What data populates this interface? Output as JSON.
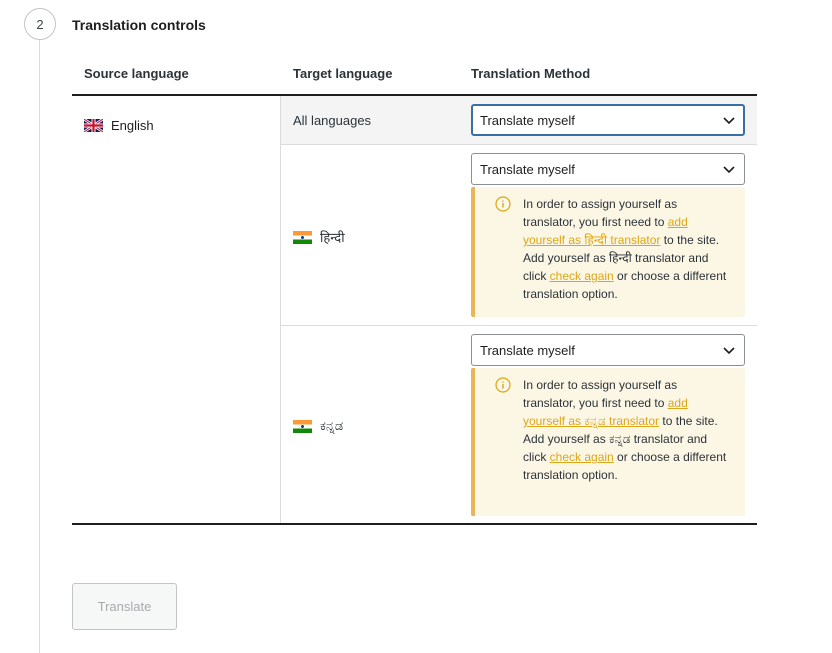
{
  "step": {
    "number": "2",
    "title": "Translation controls"
  },
  "table": {
    "headers": {
      "source": "Source language",
      "target": "Target language",
      "method": "Translation Method"
    },
    "source_language": {
      "name": "English",
      "flag": "uk-flag-icon"
    },
    "all_languages": {
      "label": "All languages",
      "method": "Translate myself"
    },
    "languages": [
      {
        "name": "हिन्दी",
        "flag": "india-flag-icon",
        "method": "Translate myself",
        "notice": {
          "text1": "In order to assign yourself as translator, you first need to ",
          "link1": "add yourself as हिन्दी translator",
          "text2": " to the site.",
          "text3": "Add yourself as हिन्दी translator and click ",
          "link2": "check again",
          "text4": " or choose a different translation option."
        }
      },
      {
        "name": "ಕನ್ನಡ",
        "flag": "india-flag-icon",
        "method": "Translate myself",
        "notice": {
          "text1": "In order to assign yourself as translator, you first need to ",
          "link1": "add yourself as ಕನ್ನಡ translator",
          "text2": " to the site.",
          "text3": "Add yourself as ಕನ್ನಡ translator and click ",
          "link2": "check again",
          "text4": " or choose a different translation option."
        }
      }
    ]
  },
  "translate_button": {
    "label": "Translate",
    "disabled": true
  },
  "colors": {
    "notice_bg": "#fcf6e5",
    "notice_border": "#e8b658",
    "link": "#dba617",
    "focus": "#3a6ea5"
  }
}
